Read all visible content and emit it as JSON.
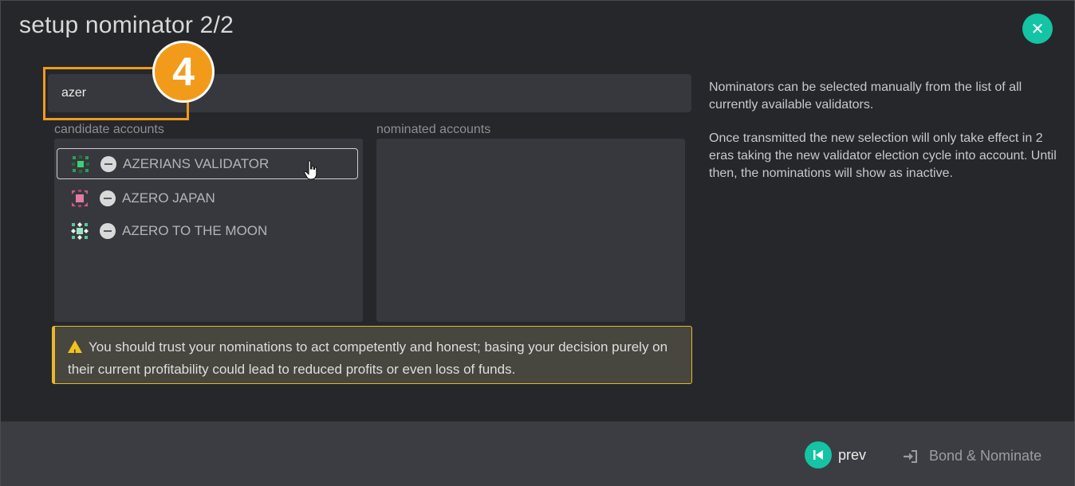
{
  "modal": {
    "title": "setup nominator 2/2",
    "close_icon": "close-icon"
  },
  "search": {
    "value": "azer"
  },
  "tutorial": {
    "step_number": "4",
    "accent_color": "#f29b1a"
  },
  "candidates": {
    "label": "candidate accounts",
    "items": [
      {
        "name": "AZERIANS VALIDATOR",
        "selected": true
      },
      {
        "name": "AZERO JAPAN",
        "selected": false
      },
      {
        "name": "AZERO TO THE MOON",
        "selected": false
      }
    ]
  },
  "nominated": {
    "label": "nominated accounts",
    "items": []
  },
  "info": {
    "paragraph1": "Nominators can be selected manually from the list of all currently available validators.",
    "paragraph2": "Once transmitted the new selection will only take effect in 2 eras taking the new validator election cycle into account. Until then, the nominations will show as inactive."
  },
  "warning": {
    "icon": "warning-icon",
    "text": "You should trust your nominations to act competently and honest; basing your decision purely on their current profitability could lead to reduced profits or even loss of funds."
  },
  "footer": {
    "prev_label": "prev",
    "bond_label": "Bond & Nominate"
  },
  "colors": {
    "accent": "#14c4a4",
    "warning": "#e8b72c",
    "background": "#26272b"
  }
}
